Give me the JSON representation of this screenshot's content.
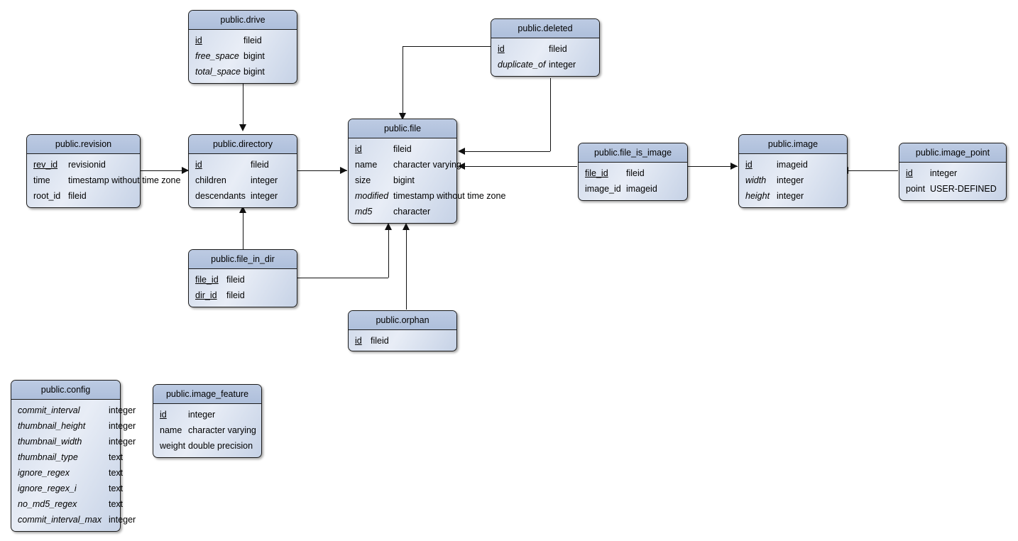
{
  "diagram": {
    "title": "public schema entity relationship diagram",
    "colors": {
      "header_fill": "#aebfdb",
      "body_fill": "#cfd9ea",
      "border": "#1a1a1a",
      "line": "#111111"
    }
  },
  "entities": [
    {
      "id": "drive",
      "name": "public.drive",
      "columns": [
        {
          "name": "id",
          "type": "fileid",
          "key": true,
          "italic": false
        },
        {
          "name": "free_space",
          "type": "bigint",
          "key": false,
          "italic": true
        },
        {
          "name": "total_space",
          "type": "bigint",
          "key": false,
          "italic": true
        }
      ]
    },
    {
      "id": "deleted",
      "name": "public.deleted",
      "columns": [
        {
          "name": "id",
          "type": "fileid",
          "key": true,
          "italic": false
        },
        {
          "name": "duplicate_of",
          "type": "integer",
          "key": false,
          "italic": true
        }
      ]
    },
    {
      "id": "revision",
      "name": "public.revision",
      "columns": [
        {
          "name": "rev_id",
          "type": "revisionid",
          "key": true,
          "italic": false
        },
        {
          "name": "time",
          "type": "timestamp without time zone",
          "key": false,
          "italic": false
        },
        {
          "name": "root_id",
          "type": "fileid",
          "key": false,
          "italic": false
        }
      ]
    },
    {
      "id": "directory",
      "name": "public.directory",
      "columns": [
        {
          "name": "id",
          "type": "fileid",
          "key": true,
          "italic": false
        },
        {
          "name": "children",
          "type": "integer",
          "key": false,
          "italic": false
        },
        {
          "name": "descendants",
          "type": "integer",
          "key": false,
          "italic": false
        }
      ]
    },
    {
      "id": "file",
      "name": "public.file",
      "columns": [
        {
          "name": "id",
          "type": "fileid",
          "key": true,
          "italic": false
        },
        {
          "name": "name",
          "type": "character varying",
          "key": false,
          "italic": false
        },
        {
          "name": "size",
          "type": "bigint",
          "key": false,
          "italic": false
        },
        {
          "name": "modified",
          "type": "timestamp without time zone",
          "key": false,
          "italic": true
        },
        {
          "name": "md5",
          "type": "character",
          "key": false,
          "italic": true
        }
      ]
    },
    {
      "id": "file_is_image",
      "name": "public.file_is_image",
      "columns": [
        {
          "name": "file_id",
          "type": "fileid",
          "key": true,
          "italic": false
        },
        {
          "name": "image_id",
          "type": "imageid",
          "key": false,
          "italic": false
        }
      ]
    },
    {
      "id": "image",
      "name": "public.image",
      "columns": [
        {
          "name": "id",
          "type": "imageid",
          "key": true,
          "italic": false
        },
        {
          "name": "width",
          "type": "integer",
          "key": false,
          "italic": true
        },
        {
          "name": "height",
          "type": "integer",
          "key": false,
          "italic": true
        }
      ]
    },
    {
      "id": "image_point",
      "name": "public.image_point",
      "columns": [
        {
          "name": "id",
          "type": "integer",
          "key": true,
          "italic": false
        },
        {
          "name": "point",
          "type": "USER-DEFINED",
          "key": false,
          "italic": false
        }
      ]
    },
    {
      "id": "file_in_dir",
      "name": "public.file_in_dir",
      "columns": [
        {
          "name": "file_id",
          "type": "fileid",
          "key": true,
          "italic": false
        },
        {
          "name": "dir_id",
          "type": "fileid",
          "key": true,
          "italic": false
        }
      ]
    },
    {
      "id": "orphan",
      "name": "public.orphan",
      "columns": [
        {
          "name": "id",
          "type": "fileid",
          "key": true,
          "italic": false
        }
      ]
    },
    {
      "id": "config",
      "name": "public.config",
      "columns": [
        {
          "name": "commit_interval",
          "type": "integer",
          "key": false,
          "italic": true
        },
        {
          "name": "thumbnail_height",
          "type": "integer",
          "key": false,
          "italic": true
        },
        {
          "name": "thumbnail_width",
          "type": "integer",
          "key": false,
          "italic": true
        },
        {
          "name": "thumbnail_type",
          "type": "text",
          "key": false,
          "italic": true
        },
        {
          "name": "ignore_regex",
          "type": "text",
          "key": false,
          "italic": true
        },
        {
          "name": "ignore_regex_i",
          "type": "text",
          "key": false,
          "italic": true
        },
        {
          "name": "no_md5_regex",
          "type": "text",
          "key": false,
          "italic": true
        },
        {
          "name": "commit_interval_max",
          "type": "integer",
          "key": false,
          "italic": true
        }
      ]
    },
    {
      "id": "image_feature",
      "name": "public.image_feature",
      "columns": [
        {
          "name": "id",
          "type": "integer",
          "key": true,
          "italic": false
        },
        {
          "name": "name",
          "type": "character varying",
          "key": false,
          "italic": false
        },
        {
          "name": "weight",
          "type": "double precision",
          "key": false,
          "italic": false
        }
      ]
    }
  ],
  "relationships": [
    {
      "from": "drive",
      "to": "directory",
      "label": ""
    },
    {
      "from": "deleted",
      "to": "file",
      "label": ""
    },
    {
      "from": "deleted",
      "to": "file",
      "label": ""
    },
    {
      "from": "revision",
      "to": "directory",
      "label": ""
    },
    {
      "from": "directory",
      "to": "file",
      "label": ""
    },
    {
      "from": "file_in_dir",
      "to": "directory",
      "label": ""
    },
    {
      "from": "file_in_dir",
      "to": "file",
      "label": ""
    },
    {
      "from": "orphan",
      "to": "file",
      "label": ""
    },
    {
      "from": "file_is_image",
      "to": "file",
      "label": ""
    },
    {
      "from": "file_is_image",
      "to": "image",
      "label": ""
    },
    {
      "from": "image_point",
      "to": "image",
      "label": ""
    }
  ]
}
